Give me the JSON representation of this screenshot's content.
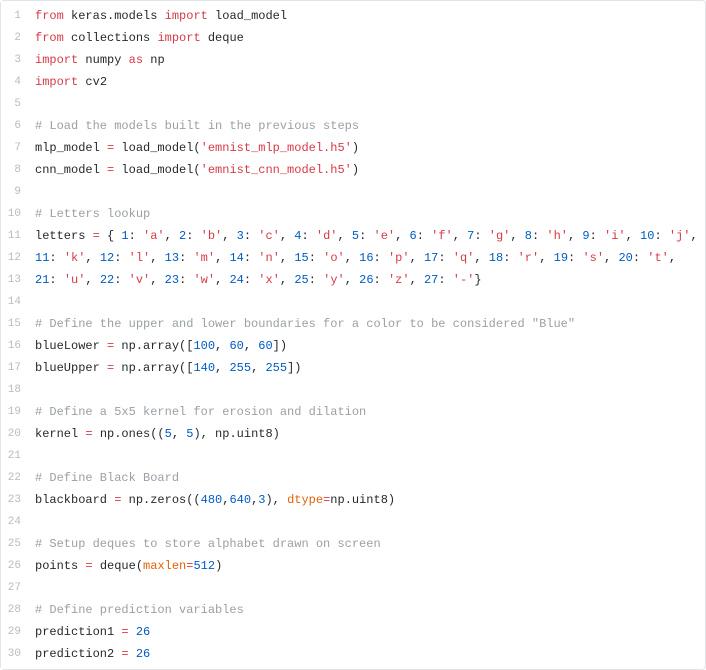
{
  "editor": {
    "lines": [
      {
        "n": "1",
        "tokens": [
          [
            "kw",
            "from"
          ],
          [
            "plain",
            " keras.models "
          ],
          [
            "kw",
            "import"
          ],
          [
            "plain",
            " load_model"
          ]
        ]
      },
      {
        "n": "2",
        "tokens": [
          [
            "kw",
            "from"
          ],
          [
            "plain",
            " collections "
          ],
          [
            "kw",
            "import"
          ],
          [
            "plain",
            " deque"
          ]
        ]
      },
      {
        "n": "3",
        "tokens": [
          [
            "kw",
            "import"
          ],
          [
            "plain",
            " numpy "
          ],
          [
            "kw",
            "as"
          ],
          [
            "plain",
            " np"
          ]
        ]
      },
      {
        "n": "4",
        "tokens": [
          [
            "kw",
            "import"
          ],
          [
            "plain",
            " cv2"
          ]
        ]
      },
      {
        "n": "5",
        "tokens": [
          [
            "plain",
            ""
          ]
        ]
      },
      {
        "n": "6",
        "tokens": [
          [
            "com",
            "# Load the models built in the previous steps"
          ]
        ]
      },
      {
        "n": "7",
        "tokens": [
          [
            "plain",
            "mlp_model "
          ],
          [
            "op",
            "="
          ],
          [
            "plain",
            " load_model("
          ],
          [
            "str",
            "'emnist_mlp_model.h5'"
          ],
          [
            "plain",
            ")"
          ]
        ]
      },
      {
        "n": "8",
        "tokens": [
          [
            "plain",
            "cnn_model "
          ],
          [
            "op",
            "="
          ],
          [
            "plain",
            " load_model("
          ],
          [
            "str",
            "'emnist_cnn_model.h5'"
          ],
          [
            "plain",
            ")"
          ]
        ]
      },
      {
        "n": "9",
        "tokens": [
          [
            "plain",
            ""
          ]
        ]
      },
      {
        "n": "10",
        "tokens": [
          [
            "com",
            "# Letters lookup"
          ]
        ]
      },
      {
        "n": "11",
        "tokens": [
          [
            "plain",
            "letters "
          ],
          [
            "op",
            "="
          ],
          [
            "plain",
            " { "
          ],
          [
            "num",
            "1"
          ],
          [
            "plain",
            ": "
          ],
          [
            "str",
            "'a'"
          ],
          [
            "plain",
            ", "
          ],
          [
            "num",
            "2"
          ],
          [
            "plain",
            ": "
          ],
          [
            "str",
            "'b'"
          ],
          [
            "plain",
            ", "
          ],
          [
            "num",
            "3"
          ],
          [
            "plain",
            ": "
          ],
          [
            "str",
            "'c'"
          ],
          [
            "plain",
            ", "
          ],
          [
            "num",
            "4"
          ],
          [
            "plain",
            ": "
          ],
          [
            "str",
            "'d'"
          ],
          [
            "plain",
            ", "
          ],
          [
            "num",
            "5"
          ],
          [
            "plain",
            ": "
          ],
          [
            "str",
            "'e'"
          ],
          [
            "plain",
            ", "
          ],
          [
            "num",
            "6"
          ],
          [
            "plain",
            ": "
          ],
          [
            "str",
            "'f'"
          ],
          [
            "plain",
            ", "
          ],
          [
            "num",
            "7"
          ],
          [
            "plain",
            ": "
          ],
          [
            "str",
            "'g'"
          ],
          [
            "plain",
            ", "
          ],
          [
            "num",
            "8"
          ],
          [
            "plain",
            ": "
          ],
          [
            "str",
            "'h'"
          ],
          [
            "plain",
            ", "
          ],
          [
            "num",
            "9"
          ],
          [
            "plain",
            ": "
          ],
          [
            "str",
            "'i'"
          ],
          [
            "plain",
            ", "
          ],
          [
            "num",
            "10"
          ],
          [
            "plain",
            ": "
          ],
          [
            "str",
            "'j'"
          ],
          [
            "plain",
            ","
          ]
        ]
      },
      {
        "n": "12",
        "tokens": [
          [
            "num",
            "11"
          ],
          [
            "plain",
            ": "
          ],
          [
            "str",
            "'k'"
          ],
          [
            "plain",
            ", "
          ],
          [
            "num",
            "12"
          ],
          [
            "plain",
            ": "
          ],
          [
            "str",
            "'l'"
          ],
          [
            "plain",
            ", "
          ],
          [
            "num",
            "13"
          ],
          [
            "plain",
            ": "
          ],
          [
            "str",
            "'m'"
          ],
          [
            "plain",
            ", "
          ],
          [
            "num",
            "14"
          ],
          [
            "plain",
            ": "
          ],
          [
            "str",
            "'n'"
          ],
          [
            "plain",
            ", "
          ],
          [
            "num",
            "15"
          ],
          [
            "plain",
            ": "
          ],
          [
            "str",
            "'o'"
          ],
          [
            "plain",
            ", "
          ],
          [
            "num",
            "16"
          ],
          [
            "plain",
            ": "
          ],
          [
            "str",
            "'p'"
          ],
          [
            "plain",
            ", "
          ],
          [
            "num",
            "17"
          ],
          [
            "plain",
            ": "
          ],
          [
            "str",
            "'q'"
          ],
          [
            "plain",
            ", "
          ],
          [
            "num",
            "18"
          ],
          [
            "plain",
            ": "
          ],
          [
            "str",
            "'r'"
          ],
          [
            "plain",
            ", "
          ],
          [
            "num",
            "19"
          ],
          [
            "plain",
            ": "
          ],
          [
            "str",
            "'s'"
          ],
          [
            "plain",
            ", "
          ],
          [
            "num",
            "20"
          ],
          [
            "plain",
            ": "
          ],
          [
            "str",
            "'t'"
          ],
          [
            "plain",
            ","
          ]
        ]
      },
      {
        "n": "13",
        "tokens": [
          [
            "num",
            "21"
          ],
          [
            "plain",
            ": "
          ],
          [
            "str",
            "'u'"
          ],
          [
            "plain",
            ", "
          ],
          [
            "num",
            "22"
          ],
          [
            "plain",
            ": "
          ],
          [
            "str",
            "'v'"
          ],
          [
            "plain",
            ", "
          ],
          [
            "num",
            "23"
          ],
          [
            "plain",
            ": "
          ],
          [
            "str",
            "'w'"
          ],
          [
            "plain",
            ", "
          ],
          [
            "num",
            "24"
          ],
          [
            "plain",
            ": "
          ],
          [
            "str",
            "'x'"
          ],
          [
            "plain",
            ", "
          ],
          [
            "num",
            "25"
          ],
          [
            "plain",
            ": "
          ],
          [
            "str",
            "'y'"
          ],
          [
            "plain",
            ", "
          ],
          [
            "num",
            "26"
          ],
          [
            "plain",
            ": "
          ],
          [
            "str",
            "'z'"
          ],
          [
            "plain",
            ", "
          ],
          [
            "num",
            "27"
          ],
          [
            "plain",
            ": "
          ],
          [
            "str",
            "'-'"
          ],
          [
            "plain",
            "}"
          ]
        ]
      },
      {
        "n": "14",
        "tokens": [
          [
            "plain",
            ""
          ]
        ]
      },
      {
        "n": "15",
        "tokens": [
          [
            "com",
            "# Define the upper and lower boundaries for a color to be considered \"Blue\""
          ]
        ]
      },
      {
        "n": "16",
        "tokens": [
          [
            "plain",
            "blueLower "
          ],
          [
            "op",
            "="
          ],
          [
            "plain",
            " np.array(["
          ],
          [
            "num",
            "100"
          ],
          [
            "plain",
            ", "
          ],
          [
            "num",
            "60"
          ],
          [
            "plain",
            ", "
          ],
          [
            "num",
            "60"
          ],
          [
            "plain",
            "])"
          ]
        ]
      },
      {
        "n": "17",
        "tokens": [
          [
            "plain",
            "blueUpper "
          ],
          [
            "op",
            "="
          ],
          [
            "plain",
            " np.array(["
          ],
          [
            "num",
            "140"
          ],
          [
            "plain",
            ", "
          ],
          [
            "num",
            "255"
          ],
          [
            "plain",
            ", "
          ],
          [
            "num",
            "255"
          ],
          [
            "plain",
            "])"
          ]
        ]
      },
      {
        "n": "18",
        "tokens": [
          [
            "plain",
            ""
          ]
        ]
      },
      {
        "n": "19",
        "tokens": [
          [
            "com",
            "# Define a 5x5 kernel for erosion and dilation"
          ]
        ]
      },
      {
        "n": "20",
        "tokens": [
          [
            "plain",
            "kernel "
          ],
          [
            "op",
            "="
          ],
          [
            "plain",
            " np.ones(("
          ],
          [
            "num",
            "5"
          ],
          [
            "plain",
            ", "
          ],
          [
            "num",
            "5"
          ],
          [
            "plain",
            "), np.uint8)"
          ]
        ]
      },
      {
        "n": "21",
        "tokens": [
          [
            "plain",
            ""
          ]
        ]
      },
      {
        "n": "22",
        "tokens": [
          [
            "com",
            "# Define Black Board"
          ]
        ]
      },
      {
        "n": "23",
        "tokens": [
          [
            "plain",
            "blackboard "
          ],
          [
            "op",
            "="
          ],
          [
            "plain",
            " np.zeros(("
          ],
          [
            "num",
            "480"
          ],
          [
            "plain",
            ","
          ],
          [
            "num",
            "640"
          ],
          [
            "plain",
            ","
          ],
          [
            "num",
            "3"
          ],
          [
            "plain",
            "), "
          ],
          [
            "arg",
            "dtype"
          ],
          [
            "op",
            "="
          ],
          [
            "plain",
            "np.uint8)"
          ]
        ]
      },
      {
        "n": "24",
        "tokens": [
          [
            "plain",
            ""
          ]
        ]
      },
      {
        "n": "25",
        "tokens": [
          [
            "com",
            "# Setup deques to store alphabet drawn on screen"
          ]
        ]
      },
      {
        "n": "26",
        "tokens": [
          [
            "plain",
            "points "
          ],
          [
            "op",
            "="
          ],
          [
            "plain",
            " deque("
          ],
          [
            "arg",
            "maxlen"
          ],
          [
            "op",
            "="
          ],
          [
            "num",
            "512"
          ],
          [
            "plain",
            ")"
          ]
        ]
      },
      {
        "n": "27",
        "tokens": [
          [
            "plain",
            ""
          ]
        ]
      },
      {
        "n": "28",
        "tokens": [
          [
            "com",
            "# Define prediction variables"
          ]
        ]
      },
      {
        "n": "29",
        "tokens": [
          [
            "plain",
            "prediction1 "
          ],
          [
            "op",
            "="
          ],
          [
            "plain",
            " "
          ],
          [
            "num",
            "26"
          ]
        ]
      },
      {
        "n": "30",
        "tokens": [
          [
            "plain",
            "prediction2 "
          ],
          [
            "op",
            "="
          ],
          [
            "plain",
            " "
          ],
          [
            "num",
            "26"
          ]
        ]
      }
    ]
  }
}
